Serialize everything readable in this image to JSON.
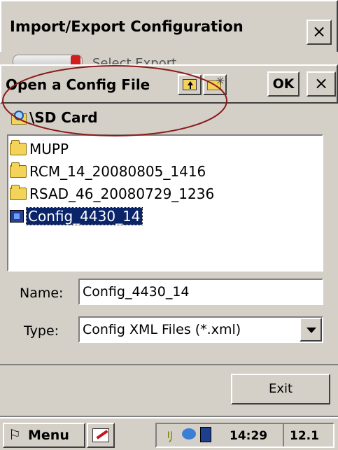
{
  "window": {
    "title": "Import/Export Configuration",
    "close_label": "×"
  },
  "hidden_row_text": "Select Export ...",
  "dialog": {
    "title": "Open a Config File",
    "ok_label": "OK",
    "close_label": "×",
    "path": "\\SD Card",
    "files": [
      {
        "name": "MUPP",
        "kind": "folder"
      },
      {
        "name": "RCM_14_20080805_1416",
        "kind": "folder"
      },
      {
        "name": "RSAD_46_20080729_1236",
        "kind": "folder"
      },
      {
        "name": "Config_4430_14",
        "kind": "config-file",
        "selected": true
      }
    ],
    "name_label": "Name:",
    "name_value": "Config_4430_14",
    "type_label": "Type:",
    "type_value": "Config XML Files (*.xml)"
  },
  "exit_label": "Exit",
  "taskbar": {
    "menu_label": "Menu",
    "time": "14:29",
    "extra": "12.1"
  },
  "colors": {
    "selection": "#0a246a",
    "annotation_circle": "#8b1a1a",
    "chrome": "#d4d0c8"
  }
}
